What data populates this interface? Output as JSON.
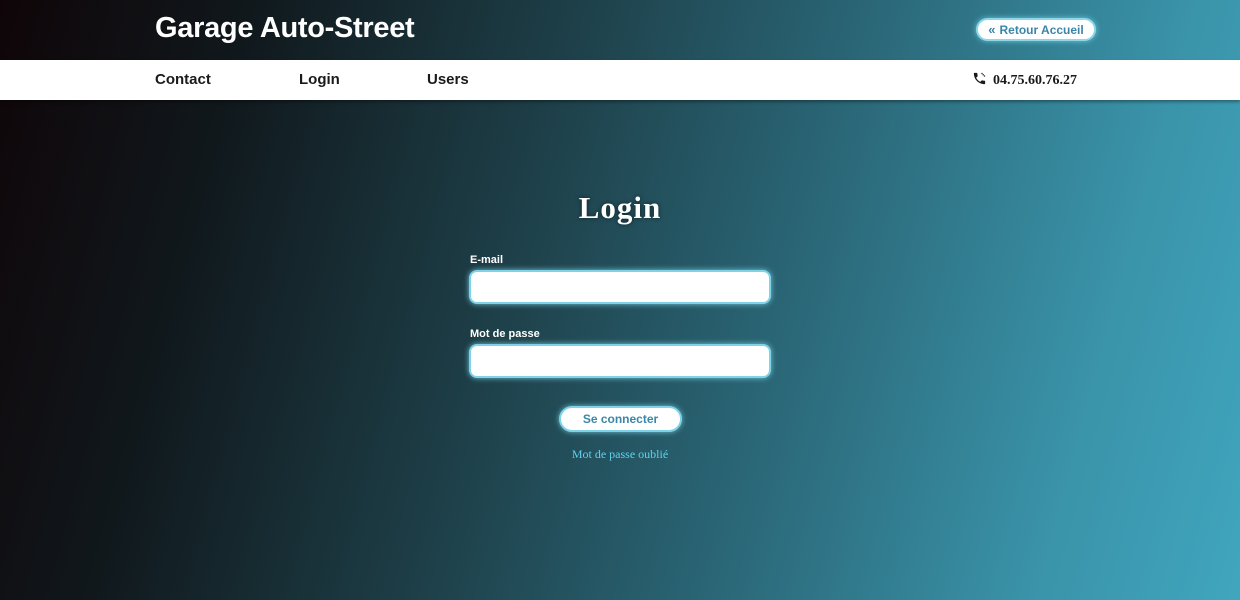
{
  "header": {
    "brand": "Garage Auto-Street",
    "retour_label": "Retour Accueil",
    "retour_icon": "double-chevron-left-icon"
  },
  "nav": {
    "items": [
      {
        "label": "Contact"
      },
      {
        "label": "Login"
      },
      {
        "label": "Users"
      }
    ],
    "phone_icon": "phone-icon",
    "phone": "04.75.60.76.27"
  },
  "login": {
    "title": "Login",
    "email_label": "E-mail",
    "email_value": "",
    "password_label": "Mot de passe",
    "password_value": "",
    "submit_label": "Se connecter",
    "forgot_label": "Mot de passe oublié"
  },
  "colors": {
    "accent": "#3a86a8",
    "field_glow": "#7fd3e6",
    "link": "#5fd3ee"
  }
}
